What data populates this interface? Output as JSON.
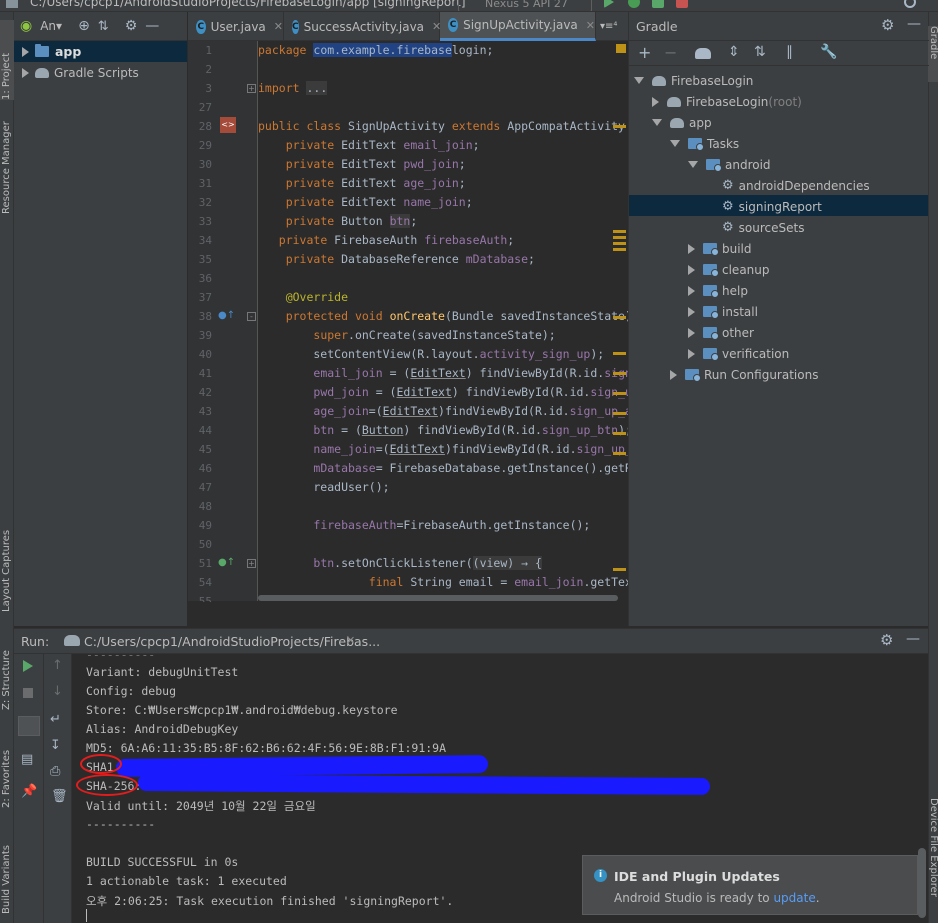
{
  "window": {
    "path": "C:/Users/cpcp1/AndroidStudioProjects/FirebaseLogin/app [signingReport]",
    "device": "Nexus 5 API 27"
  },
  "left_tabs": {
    "project": "1: Project",
    "resource_manager": "Resource Manager",
    "layout_captures": "Layout Captures",
    "structure": "Z: Structure",
    "favorites": "2: Favorites",
    "build_variants": "Build Variants"
  },
  "right_tabs": {
    "gradle": "Gradle",
    "device_file_explorer": "Device File Explorer"
  },
  "project": {
    "view_selector": "An▾",
    "items": [
      {
        "label": "app",
        "icon": "folder-icon"
      },
      {
        "label": "Gradle Scripts",
        "icon": "gradle-icon"
      }
    ]
  },
  "editor": {
    "tabs": [
      {
        "label": "User.java",
        "icon": "C"
      },
      {
        "label": "SuccessActivity.java",
        "icon": "C"
      },
      {
        "label": "SignUpActivity.java",
        "icon": "C"
      }
    ],
    "tabs_overflow": "▾≡⁴",
    "line_numbers": [
      "1",
      "2",
      "3",
      "27",
      "28",
      "29",
      "30",
      "31",
      "32",
      "33",
      "34",
      "35",
      "36",
      "37",
      "38",
      "39",
      "40",
      "41",
      "42",
      "43",
      "44",
      "45",
      "46",
      "47",
      "48",
      "49",
      "50",
      "51",
      "54",
      "55"
    ]
  },
  "gradle": {
    "title": "Gradle",
    "tree": [
      {
        "label": "FirebaseLogin",
        "suffix": "",
        "icon": "elephant"
      },
      {
        "label": "FirebaseLogin",
        "suffix": " (root)",
        "icon": "elephant"
      },
      {
        "label": "app",
        "suffix": "",
        "icon": "elephant"
      },
      {
        "label": "Tasks",
        "suffix": "",
        "icon": "folder"
      },
      {
        "label": "android",
        "suffix": "",
        "icon": "folder"
      },
      {
        "label": "androidDependencies",
        "suffix": "",
        "icon": "gear"
      },
      {
        "label": "signingReport",
        "suffix": "",
        "icon": "gear"
      },
      {
        "label": "sourceSets",
        "suffix": "",
        "icon": "gear"
      },
      {
        "label": "build",
        "suffix": "",
        "icon": "folder"
      },
      {
        "label": "cleanup",
        "suffix": "",
        "icon": "folder"
      },
      {
        "label": "help",
        "suffix": "",
        "icon": "folder"
      },
      {
        "label": "install",
        "suffix": "",
        "icon": "folder"
      },
      {
        "label": "other",
        "suffix": "",
        "icon": "folder"
      },
      {
        "label": "verification",
        "suffix": "",
        "icon": "folder"
      },
      {
        "label": "Run Configurations",
        "suffix": "",
        "icon": "folder"
      }
    ]
  },
  "run": {
    "label": "Run:",
    "tab": "C:/Users/cpcp1/AndroidStudioProjects/Firebas...",
    "output": [
      "----------",
      "Variant: debugUnitTest",
      "Config: debug",
      "Store: C:₩Users₩cpcp1₩.android₩debug.keystore",
      "Alias: AndroidDebugKey",
      "MD5: 6A:A6:11:35:B5:8F:62:B6:62:4F:56:9E:8B:F1:91:9A",
      "SHA1:",
      "SHA-256:",
      "Valid until: 2049년 10월 22일 금요일",
      "----------",
      "",
      "BUILD SUCCESSFUL in 0s",
      "1 actionable task: 1 executed",
      "오후 2:06:25: Task execution finished 'signingReport'."
    ]
  },
  "notification": {
    "title": "IDE and Plugin Updates",
    "message": "Android Studio is ready to ",
    "link": "update",
    "end": "."
  }
}
